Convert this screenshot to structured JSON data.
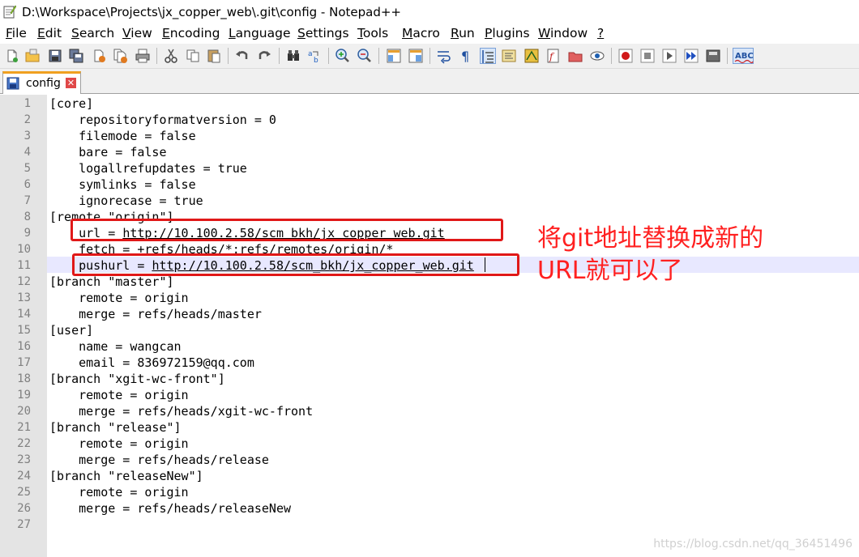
{
  "window": {
    "title": "D:\\Workspace\\Projects\\jx_copper_web\\.git\\config - Notepad++"
  },
  "menu": [
    {
      "label": "File",
      "ul": "F",
      "rest": "ile"
    },
    {
      "label": "Edit",
      "ul": "E",
      "rest": "dit"
    },
    {
      "label": "Search",
      "ul": "S",
      "rest": "earch"
    },
    {
      "label": "View",
      "ul": "V",
      "rest": "iew"
    },
    {
      "label": "Encoding",
      "ul": "E",
      "rest": "ncoding"
    },
    {
      "label": "Language",
      "ul": "L",
      "rest": "anguage"
    },
    {
      "label": "Settings",
      "ul": "S",
      "rest": "ettings"
    },
    {
      "label": "Tools",
      "ul": "T",
      "rest": "ools"
    },
    {
      "label": "Macro",
      "ul": "M",
      "rest": "acro"
    },
    {
      "label": "Run",
      "ul": "R",
      "rest": "un"
    },
    {
      "label": "Plugins",
      "ul": "P",
      "rest": "lugins"
    },
    {
      "label": "Window",
      "ul": "W",
      "rest": "indow"
    },
    {
      "label": "?",
      "ul": "?",
      "rest": ""
    }
  ],
  "toolbar": {
    "icons": [
      "new-file-icon",
      "open-file-icon",
      "save-icon",
      "save-all-icon",
      "close-icon",
      "close-all-icon",
      "print-icon",
      "cut-icon",
      "copy-icon",
      "paste-icon",
      "undo-icon",
      "redo-icon",
      "find-icon",
      "replace-icon",
      "zoom-in-icon",
      "zoom-out-icon",
      "sync-vertical-icon",
      "sync-horizontal-icon",
      "word-wrap-icon",
      "show-all-characters-icon",
      "indent-guide-icon",
      "user-language-icon",
      "document-map-icon",
      "function-list-icon",
      "folder-as-workspace-icon",
      "monitoring-icon",
      "record-macro-icon",
      "stop-recording-icon",
      "playback-macro-icon",
      "run-macro-multiple-icon",
      "save-macro-icon",
      "spell-check-icon"
    ],
    "spell_check_label": "ABC"
  },
  "tab": {
    "label": "config",
    "close_glyph": "✕"
  },
  "editor": {
    "lines": [
      {
        "no": "1",
        "indent": "",
        "text": "[core]",
        "link": "",
        "tail": ""
      },
      {
        "no": "2",
        "indent": "    ",
        "text": "repositoryformatversion = 0",
        "link": "",
        "tail": ""
      },
      {
        "no": "3",
        "indent": "    ",
        "text": "filemode = false",
        "link": "",
        "tail": ""
      },
      {
        "no": "4",
        "indent": "    ",
        "text": "bare = false",
        "link": "",
        "tail": ""
      },
      {
        "no": "5",
        "indent": "    ",
        "text": "logallrefupdates = true",
        "link": "",
        "tail": ""
      },
      {
        "no": "6",
        "indent": "    ",
        "text": "symlinks = false",
        "link": "",
        "tail": ""
      },
      {
        "no": "7",
        "indent": "    ",
        "text": "ignorecase = true",
        "link": "",
        "tail": ""
      },
      {
        "no": "8",
        "indent": "",
        "text": "[remote \"origin\"]",
        "link": "",
        "tail": ""
      },
      {
        "no": "9",
        "indent": "    ",
        "text": "url = ",
        "link": "http://10.100.2.58/scm_bkh/jx_copper_web.git",
        "tail": ""
      },
      {
        "no": "10",
        "indent": "    ",
        "text": "fetch = +refs/heads/*:refs/remotes/origin/*",
        "link": "",
        "tail": ""
      },
      {
        "no": "11",
        "indent": "    ",
        "text": "pushurl = ",
        "link": "http://10.100.2.58/scm_bkh/jx_copper_web.git",
        "tail": ""
      },
      {
        "no": "12",
        "indent": "",
        "text": "[branch \"master\"]",
        "link": "",
        "tail": ""
      },
      {
        "no": "13",
        "indent": "    ",
        "text": "remote = origin",
        "link": "",
        "tail": ""
      },
      {
        "no": "14",
        "indent": "    ",
        "text": "merge = refs/heads/master",
        "link": "",
        "tail": ""
      },
      {
        "no": "15",
        "indent": "",
        "text": "[user]",
        "link": "",
        "tail": ""
      },
      {
        "no": "16",
        "indent": "    ",
        "text": "name = wangcan",
        "link": "",
        "tail": ""
      },
      {
        "no": "17",
        "indent": "    ",
        "text": "email = 836972159@qq.com",
        "link": "",
        "tail": ""
      },
      {
        "no": "18",
        "indent": "",
        "text": "[branch \"xgit-wc-front\"]",
        "link": "",
        "tail": ""
      },
      {
        "no": "19",
        "indent": "    ",
        "text": "remote = origin",
        "link": "",
        "tail": ""
      },
      {
        "no": "20",
        "indent": "    ",
        "text": "merge = refs/heads/xgit-wc-front",
        "link": "",
        "tail": ""
      },
      {
        "no": "21",
        "indent": "",
        "text": "[branch \"release\"]",
        "link": "",
        "tail": ""
      },
      {
        "no": "22",
        "indent": "    ",
        "text": "remote = origin",
        "link": "",
        "tail": ""
      },
      {
        "no": "23",
        "indent": "    ",
        "text": "merge = refs/heads/release",
        "link": "",
        "tail": ""
      },
      {
        "no": "24",
        "indent": "",
        "text": "[branch \"releaseNew\"]",
        "link": "",
        "tail": ""
      },
      {
        "no": "25",
        "indent": "    ",
        "text": "remote = origin",
        "link": "",
        "tail": ""
      },
      {
        "no": "26",
        "indent": "    ",
        "text": "merge = refs/heads/releaseNew",
        "link": "",
        "tail": ""
      },
      {
        "no": "27",
        "indent": "",
        "text": "",
        "link": "",
        "tail": ""
      }
    ],
    "current_line": "11"
  },
  "annotation": {
    "line1": "将git地址替换成新的",
    "line2": "URL就可以了",
    "color": "#ff2020"
  },
  "watermark": "https://blog.csdn.net/qq_36451496"
}
